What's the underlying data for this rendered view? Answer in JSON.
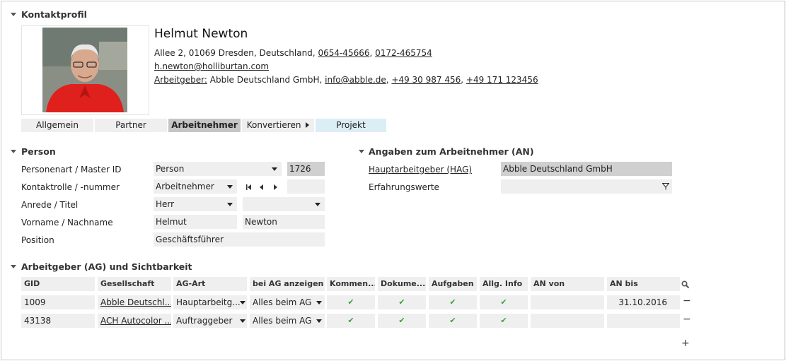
{
  "contact_profile": {
    "section_title": "Kontaktprofil",
    "name": "Helmut Newton",
    "address": "Allee 2, 01069 Dresden, Deutschland,",
    "phone1": "0654-45666",
    "phone2": "0172-465754",
    "email": "h.newton@holliburtan.com",
    "employer_label": "Arbeitgeber:",
    "employer_name": "Abble Deutschland GmbH,",
    "employer_email": "info@abble.de",
    "employer_phone1": "+49 30 987 456",
    "employer_phone2": "+49 171 123456",
    "tabs": [
      "Allgemein",
      "Partner",
      "Arbeitnehmer",
      "Konvertieren",
      "Projekt"
    ],
    "active_tab": "Arbeitnehmer"
  },
  "person": {
    "section_title": "Person",
    "labels": {
      "type": "Personenart / Master ID",
      "role": "Kontaktrolle / -nummer",
      "salutation": "Anrede / Titel",
      "name": "Vorname / Nachname",
      "position": "Position"
    },
    "values": {
      "type": "Person",
      "master_id": "1726",
      "role": "Arbeitnehmer",
      "role_number": "",
      "salutation": "Herr",
      "title": "",
      "first_name": "Helmut",
      "last_name": "Newton",
      "position": "Geschäftsführer"
    }
  },
  "employee_info": {
    "section_title": "Angaben zum Arbeitnehmer (AN)",
    "main_employer_label": "Hauptarbeitgeber (HAG)",
    "main_employer_value": "Abble Deutschland GmbH",
    "experience_label": "Erfahrungswerte",
    "experience_value": ""
  },
  "employers": {
    "section_title": "Arbeitgeber (AG) und Sichtbarkeit",
    "columns": [
      "GID",
      "Gesellschaft",
      "AG-Art",
      "bei AG anzeigen",
      "Kommen...",
      "Dokume...",
      "Aufgaben",
      "Allg. Info",
      "AN von",
      "AN bis"
    ],
    "rows": [
      {
        "gid": "1009",
        "company": "Abble Deutschl...",
        "type": "Hauptarbeitg...",
        "show": "Alles beim AG",
        "c1": "✔",
        "c2": "✔",
        "c3": "✔",
        "c4": "✔",
        "from": "",
        "to": "31.10.2016"
      },
      {
        "gid": "43138",
        "company": "ACH Autocolor ...",
        "type": "Auftraggeber",
        "show": "Alles beim AG",
        "c1": "✔",
        "c2": "✔",
        "c3": "✔",
        "c4": "✔",
        "from": "",
        "to": ""
      }
    ],
    "remove_symbol": "−",
    "add_symbol": "+"
  },
  "icons": {
    "search": "magnifier-icon",
    "filter": "funnel-icon",
    "accent_green": "#3aa23a"
  }
}
